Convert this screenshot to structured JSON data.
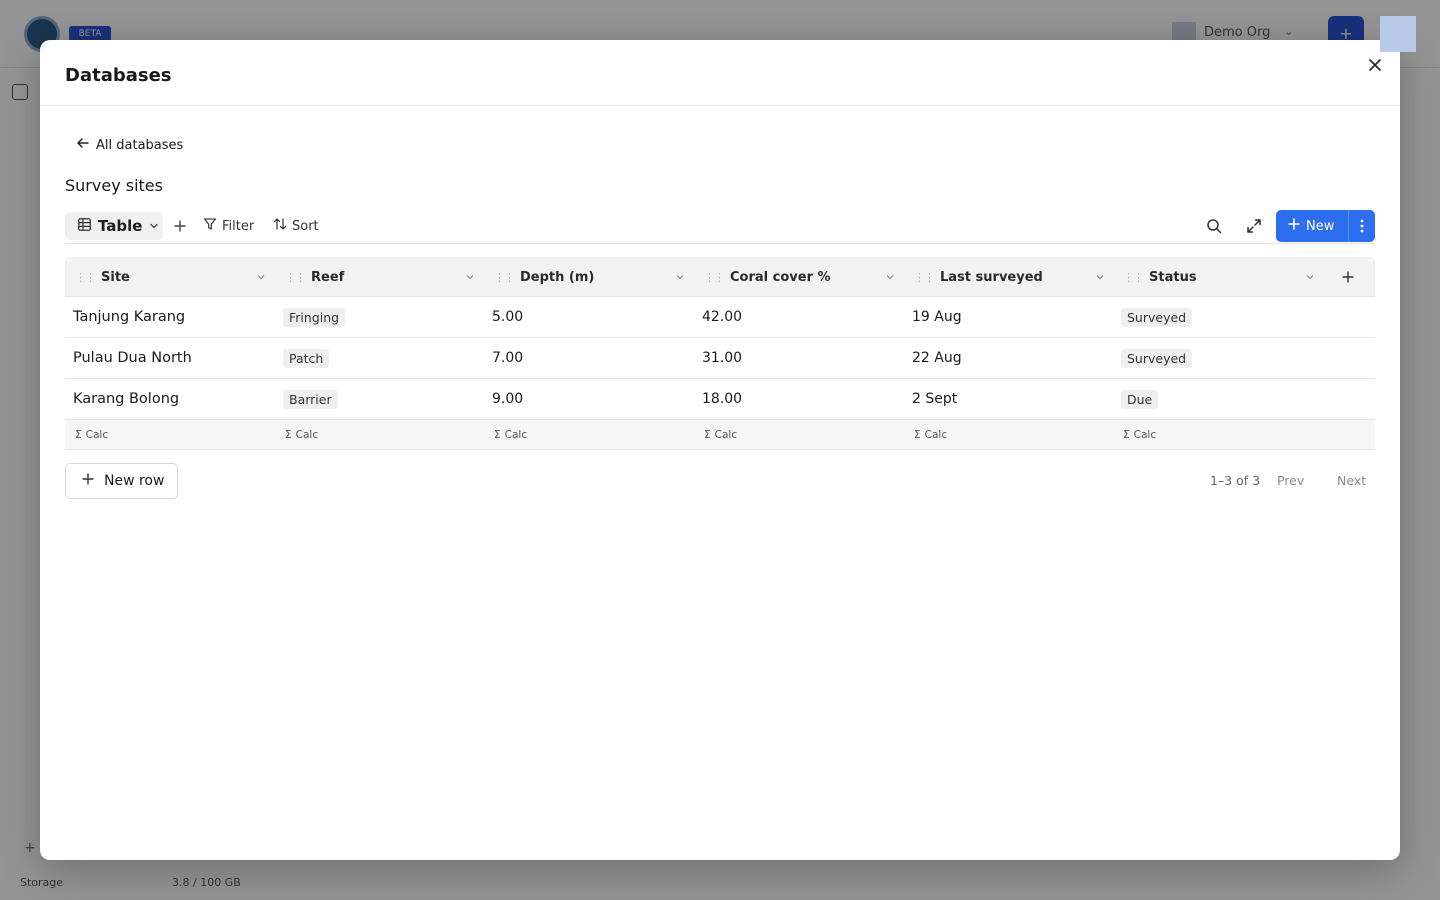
{
  "background": {
    "beta_badge": "BETA",
    "org_name": "Demo Org",
    "storage_label": "Storage",
    "storage_value": "3.8 / 100 GB"
  },
  "modal": {
    "title": "Databases",
    "back_label": "All databases",
    "database_title": "Survey sites"
  },
  "toolbar": {
    "view_label": "Table",
    "filter_label": "Filter",
    "sort_label": "Sort",
    "new_label": "New"
  },
  "table": {
    "columns": [
      "Site",
      "Reef",
      "Depth (m)",
      "Coral cover %",
      "Last surveyed",
      "Status"
    ],
    "rows": [
      {
        "site": "Tanjung Karang",
        "reef": "Fringing",
        "depth": "5.00",
        "coral_cover": "42.00",
        "last_surveyed": "19 Aug",
        "status": "Surveyed"
      },
      {
        "site": "Pulau Dua North",
        "reef": "Patch",
        "depth": "7.00",
        "coral_cover": "31.00",
        "last_surveyed": "22 Aug",
        "status": "Surveyed"
      },
      {
        "site": "Karang Bolong",
        "reef": "Barrier",
        "depth": "9.00",
        "coral_cover": "18.00",
        "last_surveyed": "2 Sept",
        "status": "Due"
      }
    ],
    "calc_label": "Calc"
  },
  "footer": {
    "new_row_label": "New row",
    "page_count": "1–3 of 3",
    "prev_label": "Prev",
    "next_label": "Next"
  },
  "colors": {
    "accent": "#2d6ef0",
    "overlay": "rgba(0,0,0,0.42)"
  }
}
